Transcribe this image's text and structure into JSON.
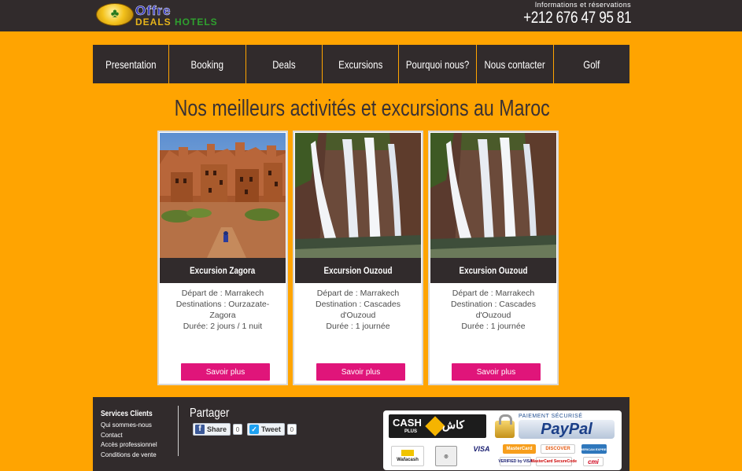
{
  "header": {
    "logo": {
      "line1": "Offre",
      "line2a": "DEALS",
      "line2b": "HOTELS"
    },
    "info_label": "Informations et réservations",
    "phone": "+212 676 47 95 81"
  },
  "nav": {
    "items": [
      "Presentation",
      "Booking",
      "Deals",
      "Excursions",
      "Pourquoi nous?",
      "Nous contacter",
      "Golf"
    ]
  },
  "main": {
    "heading": "Nos meilleurs activités et excursions au Maroc",
    "cards": [
      {
        "title": "Excursion Zagora",
        "image": "kasbah-photo",
        "lines": [
          "Départ de : Marrakech",
          "Destinations : Ourzazate-Zagora",
          "Durée: 2 jours / 1 nuit"
        ],
        "button": "Savoir plus"
      },
      {
        "title": "Excursion Ouzoud",
        "image": "waterfall-photo",
        "lines": [
          "Départ de : Marrakech",
          "Destination : Cascades d'Ouzoud",
          "Durée : 1 journée"
        ],
        "button": "Savoir plus"
      },
      {
        "title": "Excursion Ouzoud",
        "image": "waterfall-photo",
        "lines": [
          "Départ de : Marrakech",
          "Destination : Cascades d'Ouzoud",
          "Durée : 1 journée"
        ],
        "button": "Savoir plus"
      }
    ]
  },
  "footer": {
    "services_title": "Services Clients",
    "links": [
      "Qui sommes-nous",
      "Contact",
      "Accès professionnel",
      "Conditions de vente"
    ],
    "share_title": "Partager",
    "share_buttons": [
      {
        "label": "Share",
        "icon": "facebook-icon",
        "count": "0"
      },
      {
        "label": "Tweet",
        "icon": "twitter-icon",
        "count": "0"
      }
    ],
    "payment": {
      "cashplus_en": "CASH",
      "cashplus_plus": "PLUS",
      "cashplus_ar": "كاش",
      "paypal_secure": "PAIEMENT SÉCURISÉ",
      "paypal": "PayPal",
      "badges": [
        "Wafacash",
        "VISA",
        "MasterCard",
        "DISCOVER",
        "AMERICAN EXPRESS",
        "VERIFIED by VISA",
        "MasterCard SecureCode",
        "cmi"
      ]
    }
  },
  "colors": {
    "background": "#ffa401",
    "dark": "#312b2c",
    "button": "#e0157a"
  }
}
